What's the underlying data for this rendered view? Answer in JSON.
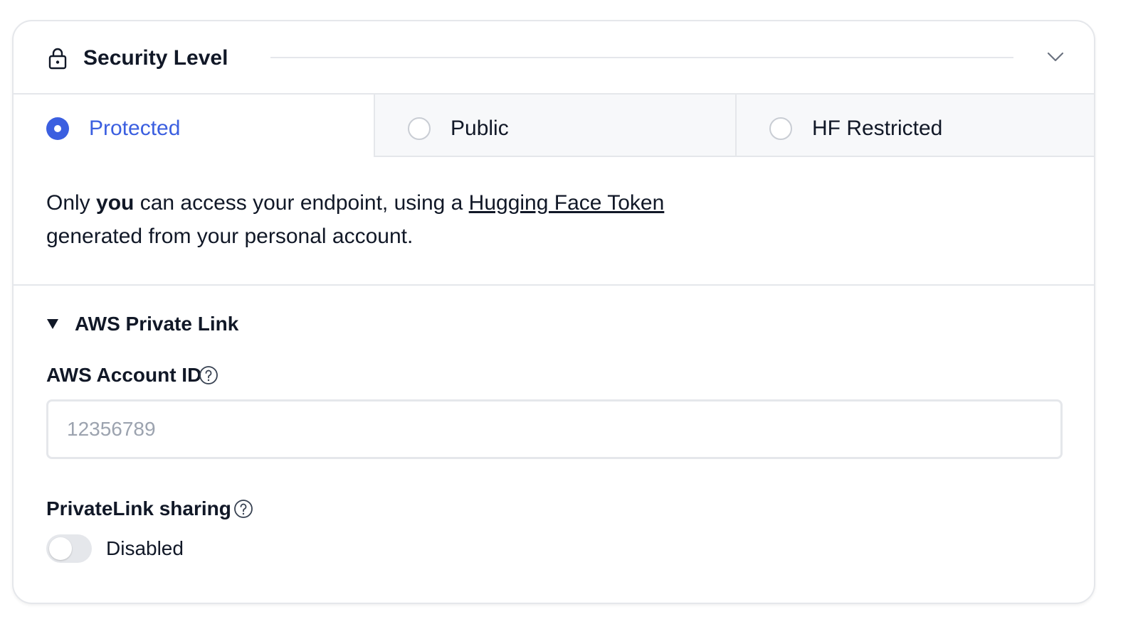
{
  "header": {
    "title": "Security Level",
    "icon": "lock-icon",
    "collapse_icon": "chevron-down-icon"
  },
  "access_options": [
    {
      "label": "Protected",
      "selected": true
    },
    {
      "label": "Public",
      "selected": false
    },
    {
      "label": "HF Restricted",
      "selected": false
    }
  ],
  "description": {
    "part1": "Only ",
    "emphasis": "you",
    "part2": " can access your endpoint, using a ",
    "link_text": "Hugging Face Token",
    "part3": " generated from your personal account."
  },
  "private_link": {
    "summary_label": "AWS Private Link",
    "expanded": true,
    "account_id": {
      "label": "AWS Account ID",
      "value": "",
      "placeholder": "12356789"
    },
    "sharing": {
      "label": "PrivateLink sharing",
      "enabled": false,
      "status_text": "Disabled"
    }
  },
  "colors": {
    "accent": "#3b5fe0",
    "border": "#e5e7eb",
    "inactive_tab_bg": "#f7f8fa",
    "text": "#111827",
    "placeholder": "#9ca3af"
  }
}
